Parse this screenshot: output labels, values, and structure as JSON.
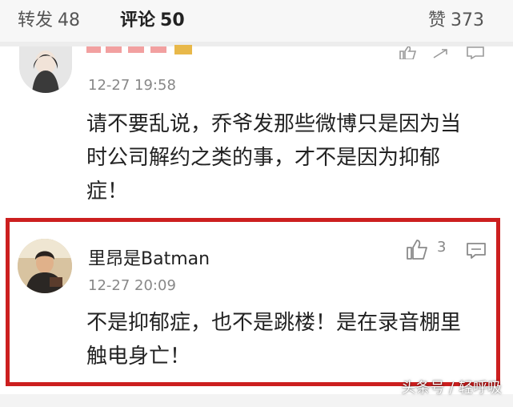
{
  "tabs": {
    "repost": {
      "label": "转发",
      "count": "48"
    },
    "comments": {
      "label": "评论",
      "count": "50"
    },
    "likes": {
      "label": "赞",
      "count": "373"
    }
  },
  "comment1": {
    "username": "",
    "timestamp": "12-27 19:58",
    "text": "请不要乱说，乔爷发那些微博只是因为当时公司解约之类的事，才不是因为抑郁症！"
  },
  "comment2": {
    "username": "里昂是Batman",
    "timestamp": "12-27 20:09",
    "like_count": "3",
    "text": "不是抑郁症，也不是跳楼！是在录音棚里触电身亡！"
  },
  "watermark": "头条号 / 轻呼吸",
  "colors": {
    "highlight": "#cc1f1f",
    "muted": "#888888"
  },
  "icons": [
    "thumbs-up-icon",
    "comment-icon",
    "avatar"
  ]
}
